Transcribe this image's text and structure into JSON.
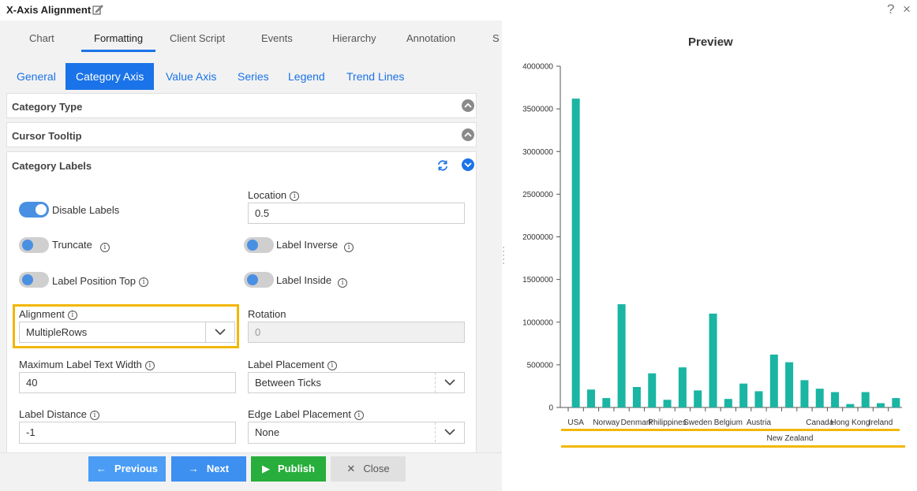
{
  "window": {
    "title": "X-Axis Alignment",
    "help_icon": "?",
    "close_icon": "×"
  },
  "tabs": [
    {
      "label": "Chart"
    },
    {
      "label": "Formatting"
    },
    {
      "label": "Client Script"
    },
    {
      "label": "Events"
    },
    {
      "label": "Hierarchy"
    },
    {
      "label": "Annotation"
    },
    {
      "label": "S"
    }
  ],
  "subtabs": [
    {
      "label": "General"
    },
    {
      "label": "Category Axis"
    },
    {
      "label": "Value Axis"
    },
    {
      "label": "Series"
    },
    {
      "label": "Legend"
    },
    {
      "label": "Trend Lines"
    }
  ],
  "sections": {
    "category_type": "Category Type",
    "cursor_tooltip": "Cursor Tooltip",
    "category_labels": "Category Labels"
  },
  "labels_form": {
    "disable_labels": {
      "label": "Disable Labels",
      "on": true
    },
    "truncate": {
      "label": "Truncate",
      "on": false
    },
    "label_position_top": {
      "label": "Label Position Top",
      "on": false
    },
    "label_inverse": {
      "label": "Label Inverse",
      "on": false
    },
    "label_inside": {
      "label": "Label Inside",
      "on": false
    },
    "location": {
      "label": "Location",
      "value": "0.5"
    },
    "alignment": {
      "label": "Alignment",
      "value": "MultipleRows"
    },
    "rotation": {
      "label": "Rotation",
      "value": "0"
    },
    "max_label_width": {
      "label": "Maximum Label Text Width",
      "value": "40"
    },
    "label_placement": {
      "label": "Label Placement",
      "value": "Between Ticks"
    },
    "label_distance": {
      "label": "Label Distance",
      "value": "-1"
    },
    "edge_label_placement": {
      "label": "Edge Label Placement",
      "value": "None"
    }
  },
  "footer": {
    "previous": "Previous",
    "next": "Next",
    "publish": "Publish",
    "close": "Close"
  },
  "preview": {
    "title": "Preview"
  },
  "colors": {
    "accent": "#1a73e8",
    "bar": "#1ab5a3",
    "highlight": "#f2b705",
    "publish": "#27ae3c"
  },
  "chart_data": {
    "type": "bar",
    "categories": [
      "USA",
      "",
      "Norway",
      "",
      "Denmark",
      "",
      "Philippines",
      "",
      "Sweden",
      "",
      "Belgium",
      "",
      "Austria",
      "",
      "New Zealand",
      "",
      "Canada",
      "",
      "Hong Kong",
      "",
      "Ireland",
      ""
    ],
    "values": [
      3620000,
      210000,
      110000,
      1210000,
      240000,
      400000,
      90000,
      470000,
      200000,
      1100000,
      100000,
      280000,
      190000,
      620000,
      530000,
      320000,
      220000,
      180000,
      40000,
      180000,
      50000,
      110000
    ],
    "yticks": [
      "0",
      "500000",
      "1000000",
      "1500000",
      "2000000",
      "2500000",
      "3000000",
      "3500000",
      "4000000"
    ],
    "ylim": [
      0,
      4000000
    ],
    "grid": false
  }
}
